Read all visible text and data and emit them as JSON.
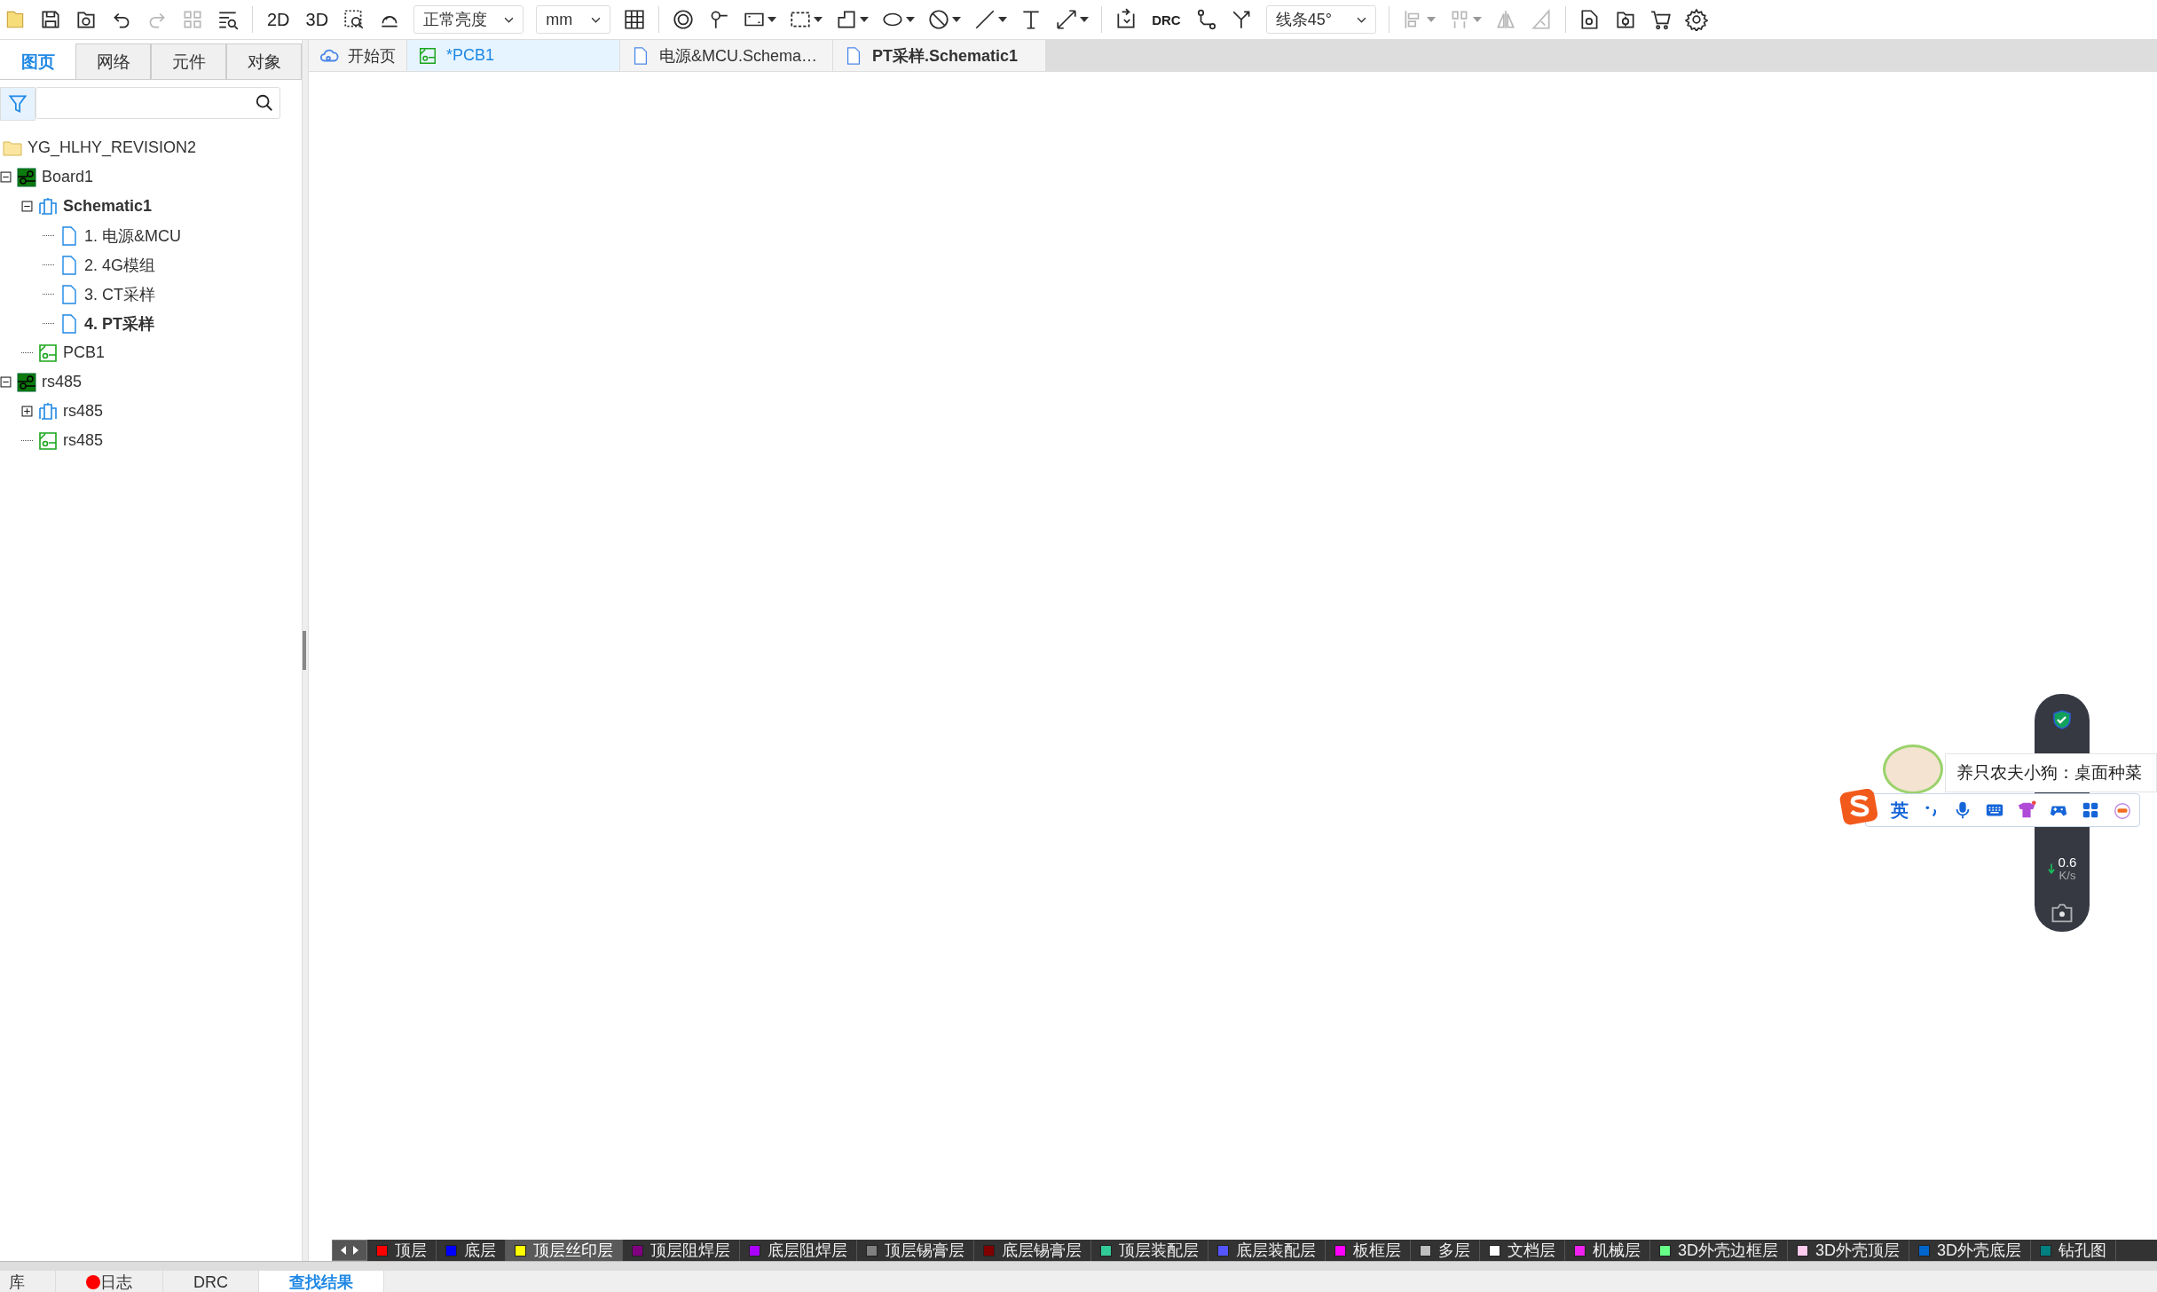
{
  "toolbar": {
    "view_2d": "2D",
    "view_3d": "3D",
    "brightness": "正常亮度",
    "unit": "mm",
    "drc": "DRC",
    "route_mode": "线条45°"
  },
  "left_panel": {
    "tabs": [
      {
        "label": "图页",
        "selected": true
      },
      {
        "label": "网络",
        "selected": false
      },
      {
        "label": "元件",
        "selected": false
      },
      {
        "label": "对象",
        "selected": false
      }
    ],
    "tree": [
      {
        "kind": "project",
        "label": "YG_HLHY_REVISION2",
        "active": false,
        "children": [
          {
            "kind": "board",
            "label": "Board1",
            "active": false,
            "expanded": true,
            "children": [
              {
                "kind": "schematic",
                "label": "Schematic1",
                "active": true,
                "expanded": true,
                "children": [
                  {
                    "kind": "page",
                    "label": "1. 电源&MCU",
                    "active": false
                  },
                  {
                    "kind": "page",
                    "label": "2. 4G模组",
                    "active": false
                  },
                  {
                    "kind": "page",
                    "label": "3. CT采样",
                    "active": false
                  },
                  {
                    "kind": "page",
                    "label": "4. PT采样",
                    "active": true
                  }
                ]
              },
              {
                "kind": "pcb",
                "label": "PCB1",
                "active": false
              }
            ]
          },
          {
            "kind": "board",
            "label": "rs485",
            "active": false,
            "expanded": true,
            "children": [
              {
                "kind": "schematic",
                "label": "rs485",
                "active": false,
                "expanded": false
              },
              {
                "kind": "pcb",
                "label": "rs485",
                "active": false
              }
            ]
          }
        ]
      }
    ]
  },
  "doc_tabs": [
    {
      "kind": "home",
      "label": "开始页",
      "selected": false,
      "active": false
    },
    {
      "kind": "pcb",
      "label": "*PCB1",
      "selected": true,
      "active": false
    },
    {
      "kind": "schematic",
      "label": "电源&MCU.Schema…",
      "selected": false,
      "active": false
    },
    {
      "kind": "schematic",
      "label": "PT采样.Schematic1",
      "selected": false,
      "active": true
    }
  ],
  "layers": [
    {
      "name": "顶层",
      "color": "#ff0000",
      "selected": false
    },
    {
      "name": "底层",
      "color": "#0000ff",
      "selected": false
    },
    {
      "name": "顶层丝印层",
      "color": "#ffff00",
      "selected": true
    },
    {
      "name": "顶层阻焊层",
      "color": "#800080",
      "selected": false
    },
    {
      "name": "底层阻焊层",
      "color": "#aa00ff",
      "selected": false
    },
    {
      "name": "顶层锡膏层",
      "color": "#808080",
      "selected": false
    },
    {
      "name": "底层锡膏层",
      "color": "#800000",
      "selected": false
    },
    {
      "name": "顶层装配层",
      "color": "#33cc99",
      "selected": false
    },
    {
      "name": "底层装配层",
      "color": "#5555ff",
      "selected": false
    },
    {
      "name": "板框层",
      "color": "#ff00ff",
      "selected": false
    },
    {
      "name": "多层",
      "color": "#c0c0c0",
      "selected": false
    },
    {
      "name": "文档层",
      "color": "#ffffff",
      "selected": false
    },
    {
      "name": "机械层",
      "color": "#f022f0",
      "selected": false
    },
    {
      "name": "3D外壳边框层",
      "color": "#66ff88",
      "selected": false
    },
    {
      "name": "3D外壳顶层",
      "color": "#ffccee",
      "selected": false
    },
    {
      "name": "3D外壳底层",
      "color": "#0066cc",
      "selected": false
    },
    {
      "name": "钻孔图",
      "color": "#008080",
      "selected": false
    }
  ],
  "bottom_tabs": [
    {
      "label": "库",
      "selected": false,
      "alert": false
    },
    {
      "label": "日志",
      "selected": false,
      "alert": true
    },
    {
      "label": "DRC",
      "selected": false,
      "alert": false
    },
    {
      "label": "查找结果",
      "selected": true,
      "alert": false
    }
  ],
  "overlay": {
    "speed": {
      "value": "0.6",
      "unit": "K/s"
    },
    "ime": {
      "mode": "英"
    },
    "notification": {
      "text": "养只农夫小狗：桌面种菜"
    }
  }
}
